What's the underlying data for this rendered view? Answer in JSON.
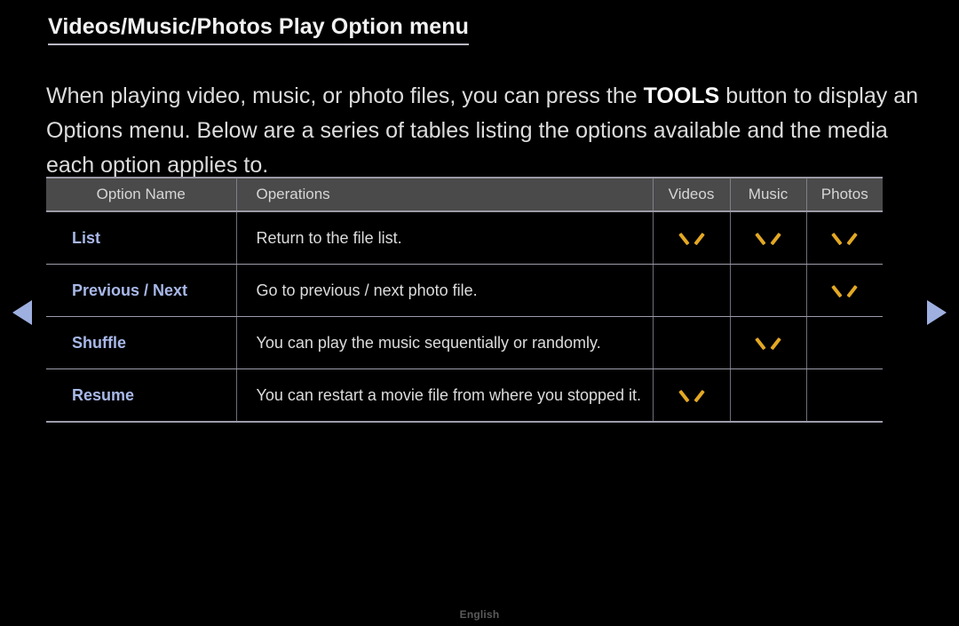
{
  "page": {
    "title": "Videos/Music/Photos Play Option menu",
    "intro_before": "When playing video, music, or photo files, you can press the ",
    "intro_emphasis": "TOOLS",
    "intro_after": " button to display an Options menu. Below are a series of tables listing the options available and the media each option applies to."
  },
  "table": {
    "headers": {
      "option_name": "Option Name",
      "operations": "Operations",
      "videos": "Videos",
      "music": "Music",
      "photos": "Photos"
    },
    "rows": [
      {
        "name": "List",
        "operation": "Return to the file list.",
        "videos": true,
        "music": true,
        "photos": true
      },
      {
        "name": "Previous / Next",
        "operation": "Go to previous / next photo file.",
        "videos": false,
        "music": false,
        "photos": true
      },
      {
        "name": "Shuffle",
        "operation": "You can play the music sequentially or randomly.",
        "videos": false,
        "music": true,
        "photos": false
      },
      {
        "name": "Resume",
        "operation": "You can restart a movie file from where you stopped it.",
        "videos": true,
        "music": false,
        "photos": false
      }
    ]
  },
  "navigation": {
    "previous_page_icon": "triangle-left-icon",
    "next_page_icon": "triangle-right-icon"
  },
  "footer": {
    "language": "English"
  },
  "colors": {
    "background": "#000000",
    "option_name": "#a8b8e8",
    "checkmark": "#e3a824",
    "header_bg": "#4a4a4a",
    "body_text": "#dcdcdc",
    "nav_arrow": "#9eb0e0",
    "footer_text": "#5a5a5a"
  }
}
